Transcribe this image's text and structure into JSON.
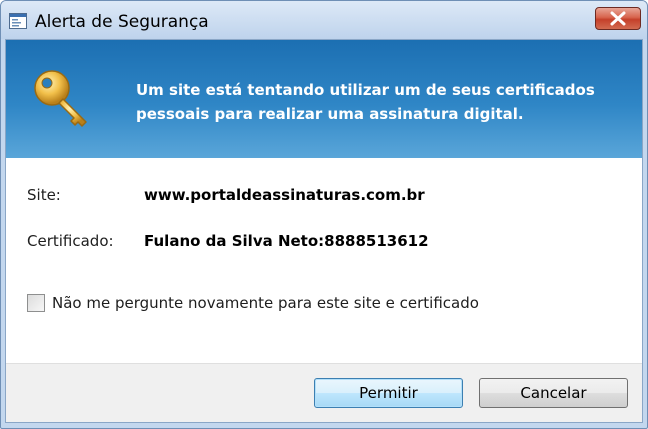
{
  "window": {
    "title": "Alerta de Segurança"
  },
  "banner": {
    "message": "Um site está tentando utilizar um de seus certificados pessoais para realizar uma assinatura digital.",
    "icon": "key-icon"
  },
  "details": {
    "site_label": "Site:",
    "site_value": "www.portaldeassinaturas.com.br",
    "certificate_label": "Certificado:",
    "certificate_value": "Fulano da Silva Neto:8888513612"
  },
  "options": {
    "dont_ask_label": "Não me pergunte novamente para este site e certificado",
    "dont_ask_checked": false
  },
  "buttons": {
    "allow_label": "Permitir",
    "cancel_label": "Cancelar"
  },
  "colors": {
    "banner": "#2f86c6",
    "close_button": "#c5402a",
    "primary_button": "#bee6fd"
  }
}
